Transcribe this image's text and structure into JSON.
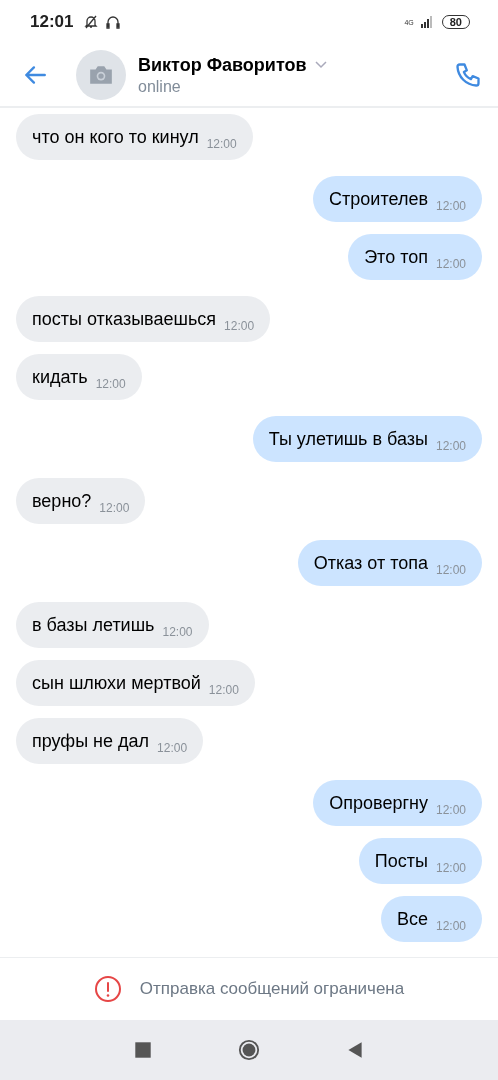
{
  "status_bar": {
    "time": "12:01",
    "network": "4G",
    "battery": "80"
  },
  "header": {
    "name": "Виктор Фаворитов",
    "status": "online"
  },
  "messages": [
    {
      "text": "что он кого то кинул",
      "time": "12:00",
      "outgoing": false
    },
    {
      "text": "Строителев",
      "time": "12:00",
      "outgoing": true
    },
    {
      "text": "Это топ",
      "time": "12:00",
      "outgoing": true
    },
    {
      "text": "посты отказываешься",
      "time": "12:00",
      "outgoing": false
    },
    {
      "text": "кидать",
      "time": "12:00",
      "outgoing": false
    },
    {
      "text": "Ты улетишь в базы",
      "time": "12:00",
      "outgoing": true
    },
    {
      "text": "верно?",
      "time": "12:00",
      "outgoing": false
    },
    {
      "text": "Отказ от топа",
      "time": "12:00",
      "outgoing": true
    },
    {
      "text": "в базы летишь",
      "time": "12:00",
      "outgoing": false
    },
    {
      "text": "сын шлюхи мертвой",
      "time": "12:00",
      "outgoing": false
    },
    {
      "text": "пруфы не дал",
      "time": "12:00",
      "outgoing": false
    },
    {
      "text": "Опровергну",
      "time": "12:00",
      "outgoing": true
    },
    {
      "text": "Посты",
      "time": "12:00",
      "outgoing": true
    },
    {
      "text": "Все",
      "time": "12:00",
      "outgoing": true
    }
  ],
  "notice": {
    "text": "Отправка сообщений ограничена"
  }
}
